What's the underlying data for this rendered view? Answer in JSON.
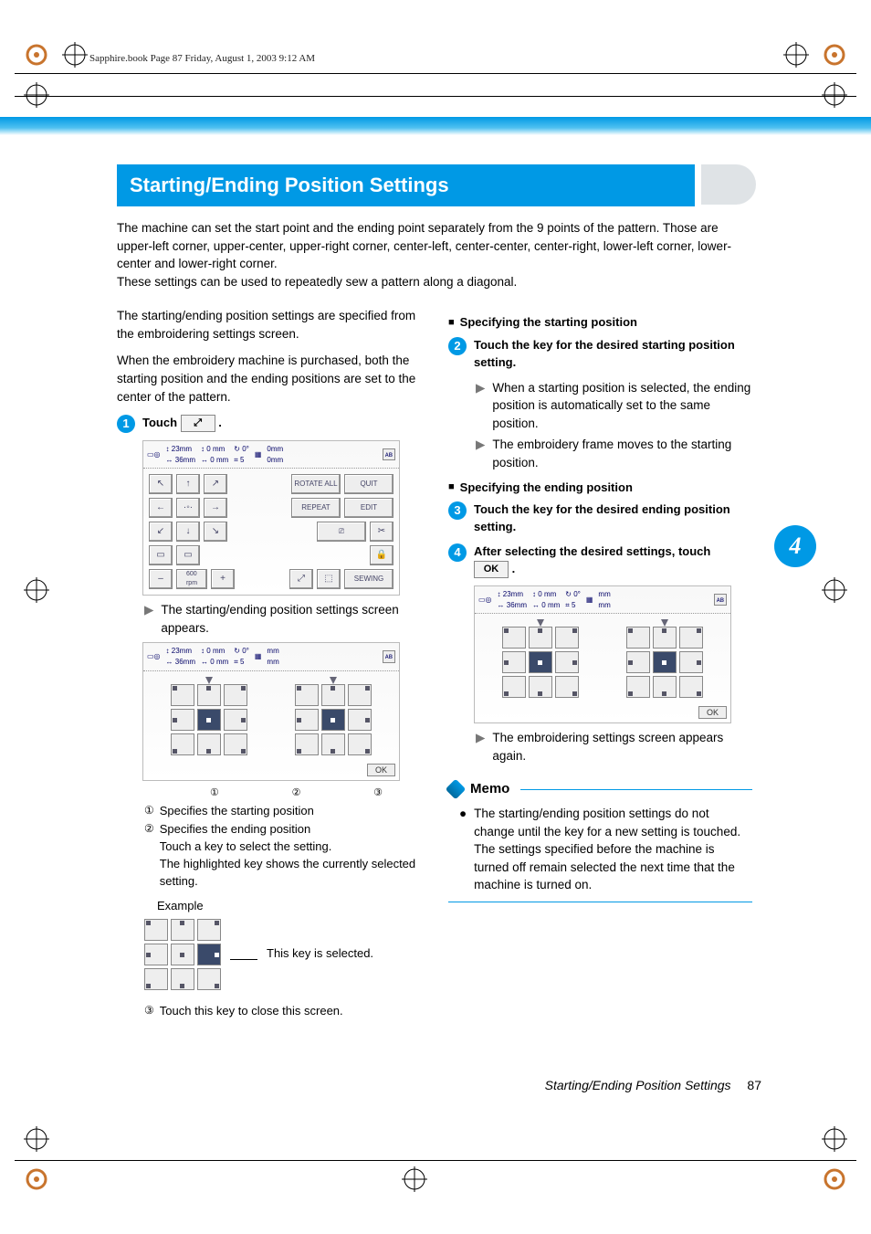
{
  "header": {
    "book_line": "Sapphire.book  Page 87  Friday, August 1, 2003  9:12 AM"
  },
  "section_title": "Starting/Ending Position Settings",
  "intro_p1": "The machine can set the start point and the ending point separately from the 9 points of the pattern. Those are upper-left corner, upper-center, upper-right corner, center-left, center-center, center-right, lower-left corner, lower-center and lower-right corner.",
  "intro_p2": "These settings can be used to repeatedly sew a pattern along a diagonal.",
  "left": {
    "p1": "The starting/ending position settings are specified from the embroidering settings screen.",
    "p2": "When the embroidery machine is purchased, both the starting position and the ending positions are set to the center of the pattern.",
    "step1_label": "Touch",
    "step1_suffix": ".",
    "step1_btn_glyph": "⤢",
    "bullet1": "The starting/ending position settings screen appears.",
    "call1": "Specifies the starting position",
    "call2_a": "Specifies the ending position",
    "call2_b": "Touch a key to select the setting.",
    "call2_c": "The highlighted key shows the currently selected setting.",
    "example_label": "Example",
    "example_caption": "This key is selected.",
    "call3": "Touch this key to close this screen.",
    "screen1": {
      "h": "23mm",
      "w": "36mm",
      "dx": "0",
      "dy": "0",
      "unit": "mm",
      "rot": "0°",
      "zoom": "5",
      "ox": "0mm",
      "oy": "0mm",
      "rotate_all": "ROTATE ALL",
      "repeat": "REPEAT",
      "quit": "QUIT",
      "edit": "EDIT",
      "sewing": "SEWING",
      "plus": "+",
      "minus": "–",
      "rpm": "600\nrpm"
    },
    "screen2": {
      "ok": "OK"
    },
    "circ": {
      "c1": "①",
      "c2": "②",
      "c3": "③"
    }
  },
  "right": {
    "sub1": "Specifying the starting position",
    "step2": "Touch the key for the desired starting position setting.",
    "b2a": "When a starting position is selected, the ending position is automatically set to the same position.",
    "b2b": "The embroidery frame moves to the starting position.",
    "sub2": "Specifying the ending position",
    "step3": "Touch the key for the desired ending position setting.",
    "step4a": "After selecting the desired settings, touch",
    "step4b": ".",
    "ok_label": "OK",
    "b4": "The embroidering settings screen appears again.",
    "memo_title": "Memo",
    "memo_text": "The starting/ending position settings do not change until the key for a new setting is touched. The settings specified before the machine is turned off remain selected the next time that the machine is turned on.",
    "screen": {
      "h": "23mm",
      "w": "36mm",
      "dx": "0",
      "dy": "0",
      "unit": "mm",
      "rot": "0°",
      "zoom": "5",
      "om": "mm",
      "ok": "OK"
    }
  },
  "side_tab": "4",
  "footer_title": "Starting/Ending Position Settings",
  "page_number": "87"
}
